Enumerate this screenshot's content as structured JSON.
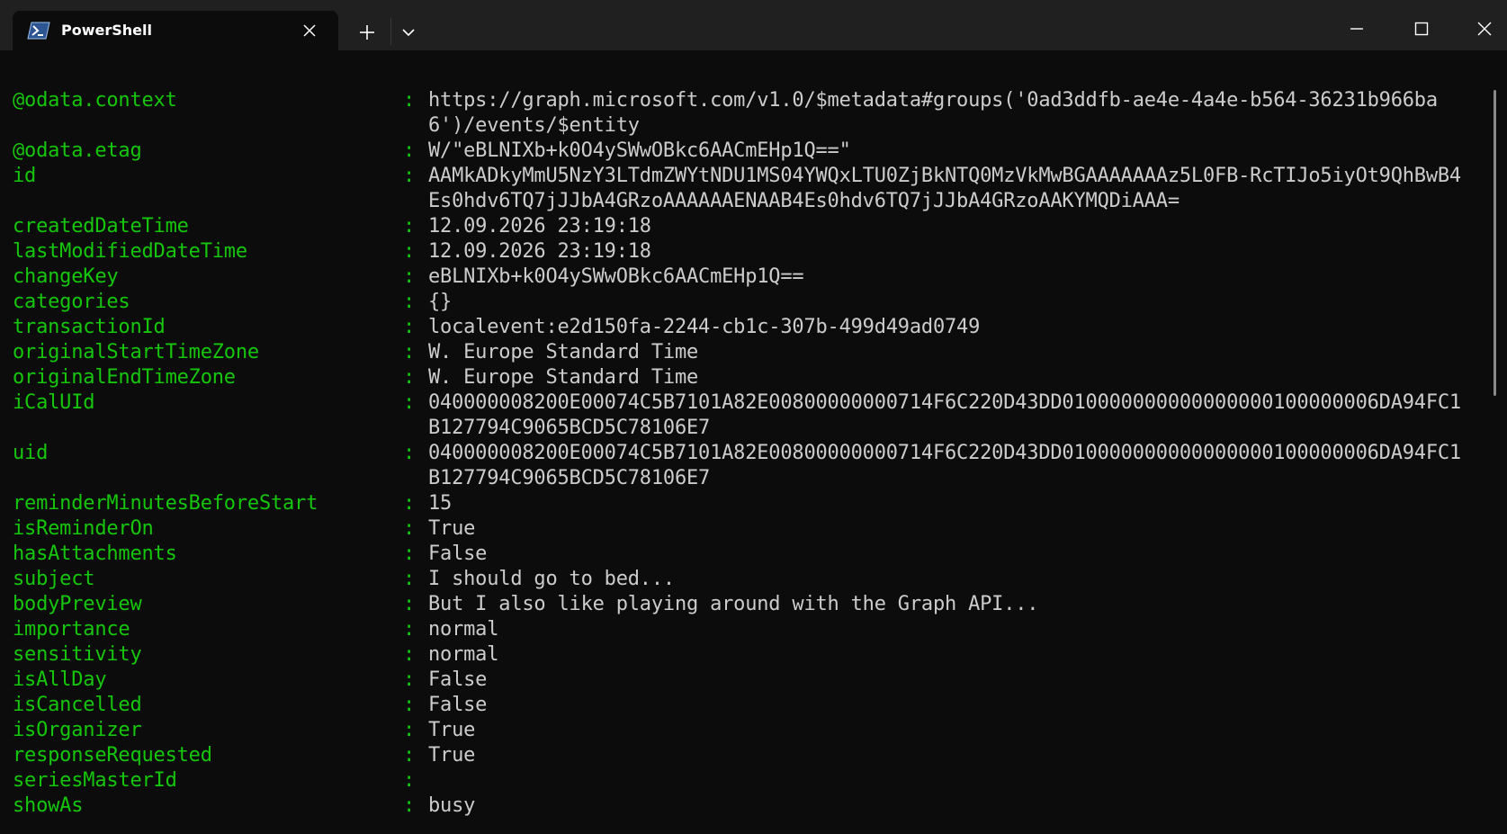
{
  "tab": {
    "title": "PowerShell",
    "icon": "powershell-icon"
  },
  "titlebar": {
    "new_tab_icon": "plus-icon",
    "dropdown_icon": "chevron-down-icon",
    "minimize_icon": "minimize-icon",
    "maximize_icon": "maximize-icon",
    "close_icon": "close-icon"
  },
  "colors": {
    "key": "#16c60c",
    "value": "#cccccc",
    "background": "#0c0c0c",
    "titlebar": "#202020"
  },
  "output": {
    "separator": ":",
    "rows": [
      {
        "key": "@odata.context",
        "value": "https://graph.microsoft.com/v1.0/$metadata#groups('0ad3ddfb-ae4e-4a4e-b564-36231b966ba6')/events/$entity"
      },
      {
        "key": "@odata.etag",
        "value": "W/\"eBLNIXb+k0O4ySWwOBkc6AACmEHp1Q==\""
      },
      {
        "key": "id",
        "value": "AAMkADkyMmU5NzY3LTdmZWYtNDU1MS04YWQxLTU0ZjBkNTQ0MzVkMwBGAAAAAAAz5L0FB-RcTIJo5iyOt9QhBwB4Es0hdv6TQ7jJJbA4GRzoAAAAAAENAAB4Es0hdv6TQ7jJJbA4GRzoAAKYMQDiAAA="
      },
      {
        "key": "createdDateTime",
        "value": "12.09.2026 23:19:18"
      },
      {
        "key": "lastModifiedDateTime",
        "value": "12.09.2026 23:19:18"
      },
      {
        "key": "changeKey",
        "value": "eBLNIXb+k0O4ySWwOBkc6AACmEHp1Q=="
      },
      {
        "key": "categories",
        "value": "{}"
      },
      {
        "key": "transactionId",
        "value": "localevent:e2d150fa-2244-cb1c-307b-499d49ad0749"
      },
      {
        "key": "originalStartTimeZone",
        "value": "W. Europe Standard Time"
      },
      {
        "key": "originalEndTimeZone",
        "value": "W. Europe Standard Time"
      },
      {
        "key": "iCalUId",
        "value": "040000008200E00074C5B7101A82E00800000000714F6C220D43DD010000000000000000100000006DA94FC1B127794C9065BCD5C78106E7"
      },
      {
        "key": "uid",
        "value": "040000008200E00074C5B7101A82E00800000000714F6C220D43DD010000000000000000100000006DA94FC1B127794C9065BCD5C78106E7"
      },
      {
        "key": "reminderMinutesBeforeStart",
        "value": "15"
      },
      {
        "key": "isReminderOn",
        "value": "True"
      },
      {
        "key": "hasAttachments",
        "value": "False"
      },
      {
        "key": "subject",
        "value": "I should go to bed..."
      },
      {
        "key": "bodyPreview",
        "value": "But I also like playing around with the Graph API..."
      },
      {
        "key": "importance",
        "value": "normal"
      },
      {
        "key": "sensitivity",
        "value": "normal"
      },
      {
        "key": "isAllDay",
        "value": "False"
      },
      {
        "key": "isCancelled",
        "value": "False"
      },
      {
        "key": "isOrganizer",
        "value": "True"
      },
      {
        "key": "responseRequested",
        "value": "True"
      },
      {
        "key": "seriesMasterId",
        "value": ""
      },
      {
        "key": "showAs",
        "value": "busy"
      }
    ]
  }
}
